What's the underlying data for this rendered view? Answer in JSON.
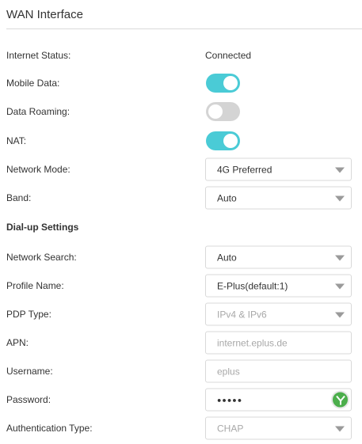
{
  "header": {
    "title": "WAN Interface"
  },
  "wan": {
    "internet_status": {
      "label": "Internet Status:",
      "value": "Connected"
    },
    "mobile_data": {
      "label": "Mobile Data:",
      "on": true
    },
    "data_roaming": {
      "label": "Data Roaming:",
      "on": false
    },
    "nat": {
      "label": "NAT:",
      "on": true
    },
    "network_mode": {
      "label": "Network Mode:",
      "value": "4G Preferred"
    },
    "band": {
      "label": "Band:",
      "value": "Auto"
    }
  },
  "dialup": {
    "section_title": "Dial-up Settings",
    "network_search": {
      "label": "Network Search:",
      "value": "Auto"
    },
    "profile_name": {
      "label": "Profile Name:",
      "value": "E-Plus(default:1)"
    },
    "pdp_type": {
      "label": "PDP Type:",
      "value": "IPv4 & IPv6"
    },
    "apn": {
      "label": "APN:",
      "value": "internet.eplus.de"
    },
    "username": {
      "label": "Username:",
      "value": "eplus"
    },
    "password": {
      "label": "Password:",
      "value": "●●●●●",
      "icon": "show-password-icon"
    },
    "auth_type": {
      "label": "Authentication Type:",
      "value": "CHAP"
    }
  },
  "colors": {
    "toggle_on": "#4acbd6",
    "toggle_off": "#d4d4d4",
    "password_icon": "#4cae4c"
  }
}
